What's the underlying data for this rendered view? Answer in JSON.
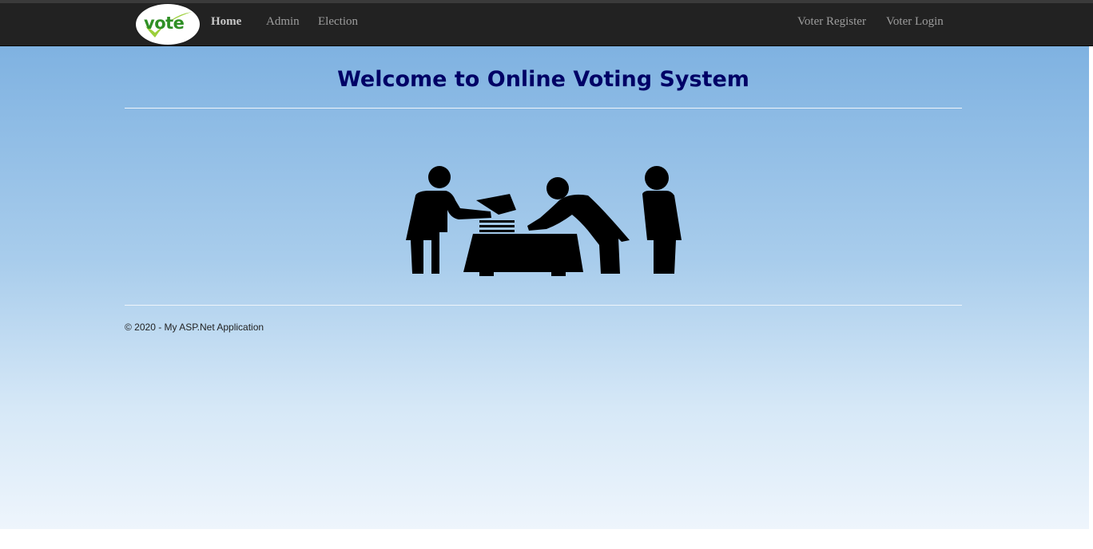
{
  "nav": {
    "logo_text": "vote",
    "links": [
      {
        "label": "Home"
      },
      {
        "label": "Admin"
      },
      {
        "label": "Election"
      }
    ],
    "right_links": [
      {
        "label": "Voter Register"
      },
      {
        "label": "Voter Login"
      }
    ]
  },
  "main": {
    "title": "Welcome to Online Voting System",
    "hero_icon": "voting-people-icon"
  },
  "footer": {
    "text": "© 2020 - My ASP.Net Application"
  }
}
